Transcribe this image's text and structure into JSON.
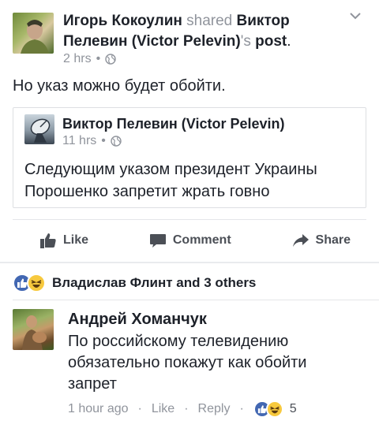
{
  "post": {
    "author": "Игорь Кокоулин",
    "shared_word": "shared",
    "shared_author": "Виктор Пелевин (Victor Pelevin)",
    "shared_suffix": "'s",
    "post_word": "post",
    "period": ".",
    "time": "2 hrs",
    "bullet": "•",
    "text": "Но указ можно будет обойти."
  },
  "shared_post": {
    "author": "Виктор Пелевин (Victor Pelevin)",
    "time": "11 hrs",
    "bullet": "•",
    "text": "Следующим указом президент Украины Порошенко запретит жрать говно"
  },
  "actions": {
    "like": "Like",
    "comment": "Comment",
    "share": "Share"
  },
  "reactions": {
    "names": "Владислав Флинт and 3 others"
  },
  "comment": {
    "author": "Андрей Хоманчук",
    "text": "По российскому телевидению обязательно покажут как обойти запрет",
    "time": "1 hour ago",
    "dot": "·",
    "like": "Like",
    "reply": "Reply",
    "count": "5"
  },
  "colors": {
    "text": "#1d2129",
    "muted": "#90949c",
    "action": "#4b4f56",
    "like_blue": "#4267b2",
    "haha_yellow": "#f7c93e"
  }
}
